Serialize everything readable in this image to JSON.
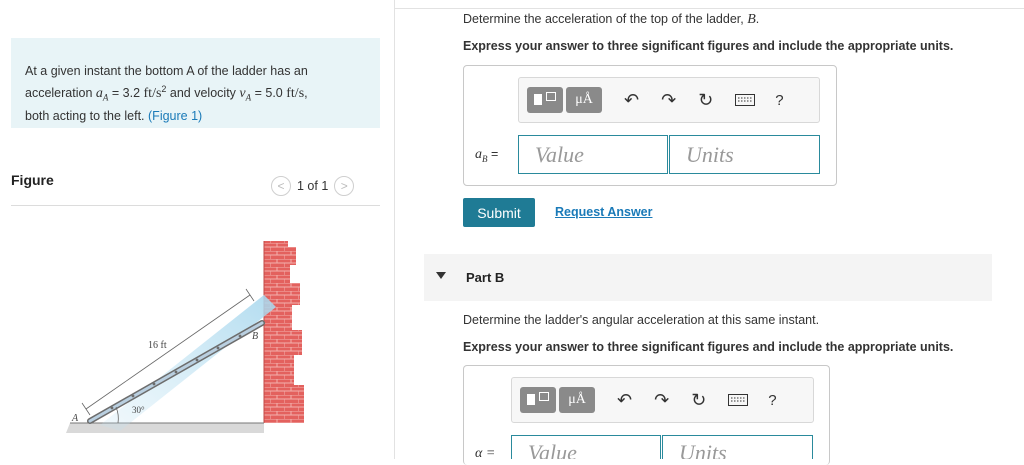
{
  "problem": {
    "text_lead": "At a given instant the bottom A of the ladder has an acceleration",
    "accel_symbol": "a",
    "accel_sub": "A",
    "accel_value": "= 3.2",
    "accel_unit": "ft/s",
    "accel_unit_exp": "2",
    "mid_text": "and velocity",
    "vel_symbol": "v",
    "vel_sub": "A",
    "vel_value": "= 5.0",
    "vel_unit": "ft/s",
    "tail_text": ",",
    "line3": "both acting to the left.",
    "figure_link": "(Figure 1)"
  },
  "figure_panel": {
    "label": "Figure",
    "pager_text": "1 of 1",
    "prev_glyph": "<",
    "next_glyph": ">",
    "dim_label": "16 ft",
    "angle_label": "30°",
    "point_a": "A",
    "point_b": "B"
  },
  "part_a": {
    "prompt": "Determine the acceleration of the top of the ladder,",
    "prompt_symbol": "B",
    "instruction": "Express your answer to three significant figures and include the appropriate units.",
    "var_label": "a",
    "var_sub": "B",
    "var_eq": "=",
    "value_placeholder": "Value",
    "units_placeholder": "Units",
    "submit_label": "Submit",
    "request_label": "Request Answer"
  },
  "toolbar": {
    "mu_label": "μÅ",
    "help_label": "?"
  },
  "part_b": {
    "header": "Part B",
    "prompt": "Determine the ladder's angular acceleration at this same instant.",
    "instruction": "Express your answer to three significant figures and include the appropriate units.",
    "var_label": "α =",
    "value_placeholder": "Value",
    "units_placeholder": "Units"
  }
}
